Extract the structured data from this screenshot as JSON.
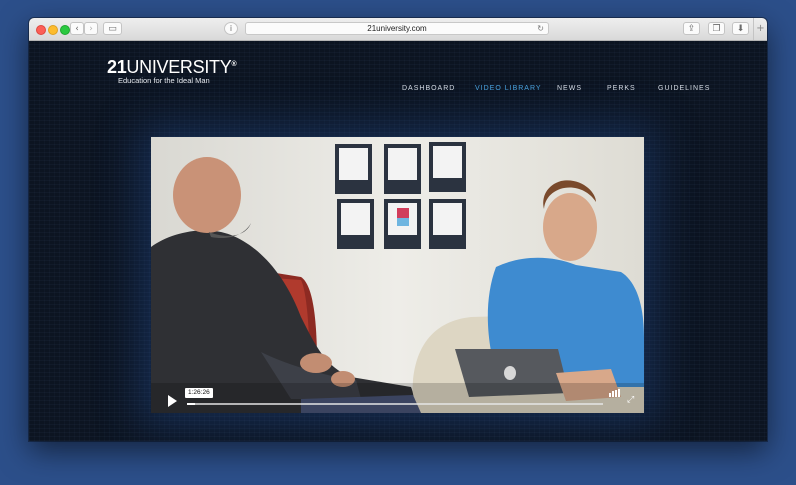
{
  "browser": {
    "url": "21university.com",
    "buttons": {
      "back": "‹",
      "forward": "›",
      "sidebar": "▭",
      "share": "⇪",
      "tabs": "❐",
      "download": "⬇",
      "reload": "↻",
      "new_tab": "+"
    },
    "icons": {
      "site_info": "i"
    }
  },
  "site": {
    "logo": {
      "number": "21",
      "word": "UNIVERSITY",
      "mark": "®",
      "tagline": "Education for the Ideal Man"
    },
    "nav": [
      {
        "label": "DASHBOARD",
        "active": false
      },
      {
        "label": "VIDEO LIBRARY",
        "active": true
      },
      {
        "label": "NEWS",
        "active": false
      },
      {
        "label": "PERKS",
        "active": false
      },
      {
        "label": "GUIDELINES",
        "active": false
      }
    ],
    "accent_color": "#4aa3df"
  },
  "video": {
    "current_time_label": "1:26:26",
    "progress_fraction": 0.02
  }
}
